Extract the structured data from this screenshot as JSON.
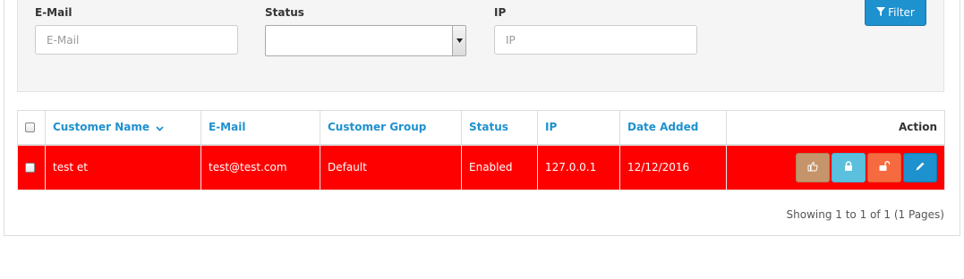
{
  "filter": {
    "email_label": "E-Mail",
    "email_placeholder": "E-Mail",
    "status_label": "Status",
    "status_value": "",
    "ip_label": "IP",
    "ip_placeholder": "IP",
    "filter_button": "Filter",
    "filter_icon": "funnel-icon"
  },
  "table": {
    "headers": [
      "Customer Name",
      "E-Mail",
      "Customer Group",
      "Status",
      "IP",
      "Date Added",
      "Action"
    ],
    "sort_icon": "chevron-down-icon",
    "rows": [
      {
        "name": "test et",
        "email": "test@test.com",
        "group": "Default",
        "status": "Enabled",
        "ip": "127.0.0.1",
        "date_added": "12/12/2016",
        "row_color": "#ff0000",
        "actions": [
          "thumbs-up-icon",
          "lock-icon",
          "unlock-icon",
          "pencil-icon"
        ]
      }
    ]
  },
  "pagination": {
    "text": "Showing 1 to 1 of 1 (1 Pages)"
  },
  "colors": {
    "link": "#1e91cf",
    "row_highlight": "#ff0000",
    "approve": "#c5946a",
    "lock": "#5bc0de",
    "unlock": "#f56b3f",
    "edit": "#1e91cf"
  }
}
